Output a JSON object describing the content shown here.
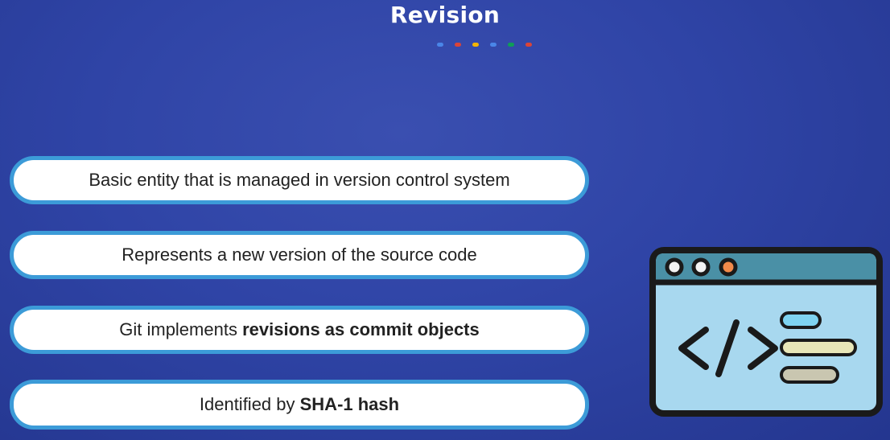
{
  "slide": {
    "title": "Revision",
    "dot_colors": [
      "#4a86e8",
      "#db4437",
      "#f4b400",
      "#4a86e8",
      "#0f9d58",
      "#db4437"
    ],
    "points": [
      {
        "text": "Basic entity that is managed in version control system"
      },
      {
        "text": "Represents a new version of the source code"
      },
      {
        "prefix": "Git implements ",
        "bold": "revisions as commit objects"
      },
      {
        "prefix": "Identified by ",
        "bold": "SHA-1 hash"
      }
    ],
    "illustration": {
      "icon": "code-window-icon",
      "window_buttons": [
        "#f3f3f3",
        "#f3f3f3",
        "#f28a4a"
      ],
      "code_symbol": "</>"
    }
  }
}
